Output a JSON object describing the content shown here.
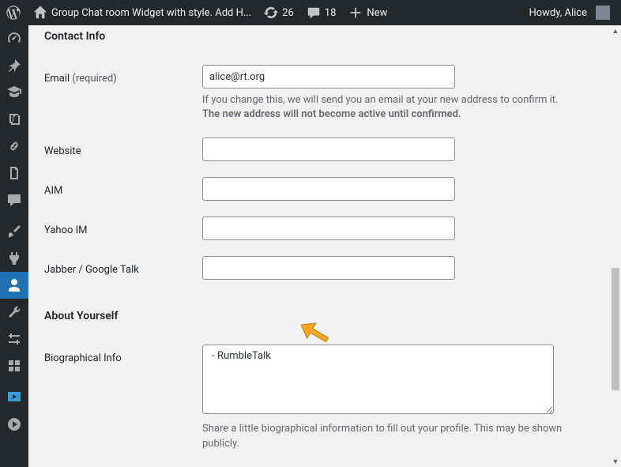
{
  "adminbar": {
    "site_title": "Group Chat room Widget with style. Add H...",
    "refresh_count": "26",
    "comment_count": "18",
    "new_label": "New",
    "greeting": "Howdy, Alice"
  },
  "sections": {
    "contact_info": "Contact Info",
    "about_yourself": "About Yourself"
  },
  "fields": {
    "email": {
      "label": "Email",
      "required": "(required)",
      "value": "alice@rt.org",
      "desc_1": "If you change this, we will send you an email at your new address to confirm it. ",
      "desc_2": "The new address will not become active until confirmed."
    },
    "website": {
      "label": "Website",
      "value": ""
    },
    "aim": {
      "label": "AIM",
      "value": ""
    },
    "yim": {
      "label": "Yahoo IM",
      "value": ""
    },
    "jabber": {
      "label": "Jabber / Google Talk",
      "value": ""
    },
    "bio": {
      "label": "Biographical Info",
      "value": " - RumbleTalk",
      "desc": "Share a little biographical information to fill out your profile. This may be shown publicly."
    }
  }
}
